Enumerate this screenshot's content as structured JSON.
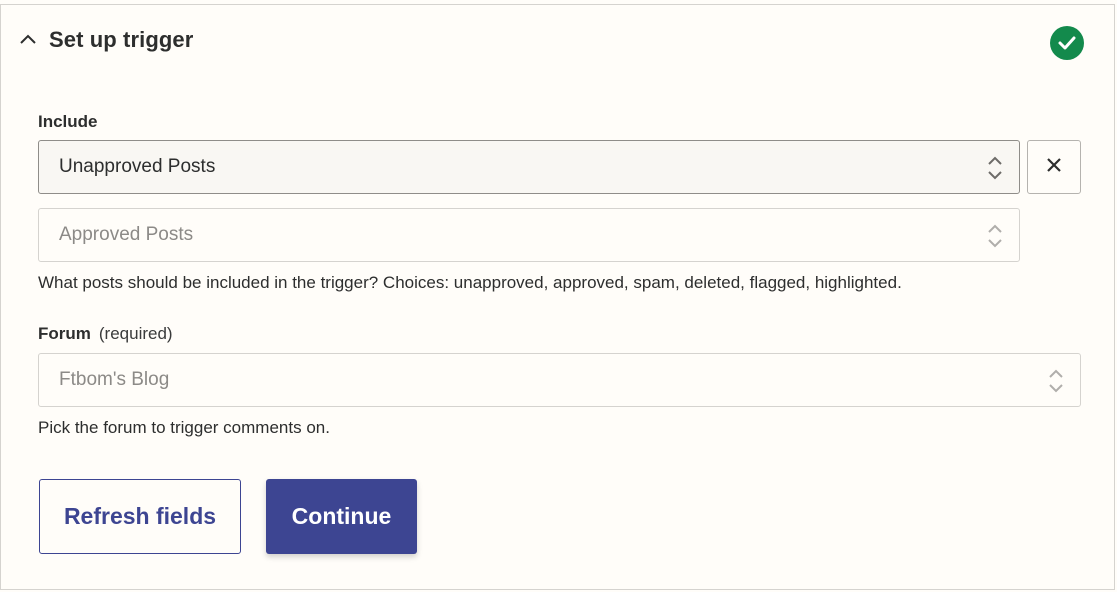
{
  "section": {
    "title": "Set up trigger",
    "status_icon": "check-circle-icon",
    "status_color": "#138a4c"
  },
  "include": {
    "label": "Include",
    "selected_value": "Unapproved Posts",
    "second_placeholder": "Approved Posts",
    "help_text": "What posts should be included in the trigger? Choices: unapproved, approved, spam, deleted, flagged, highlighted."
  },
  "forum": {
    "label": "Forum",
    "required_text": "(required)",
    "placeholder": "Ftbom's Blog",
    "help_text": "Pick the forum to trigger comments on."
  },
  "actions": {
    "refresh_label": "Refresh fields",
    "continue_label": "Continue",
    "accent_color": "#3d4592"
  }
}
